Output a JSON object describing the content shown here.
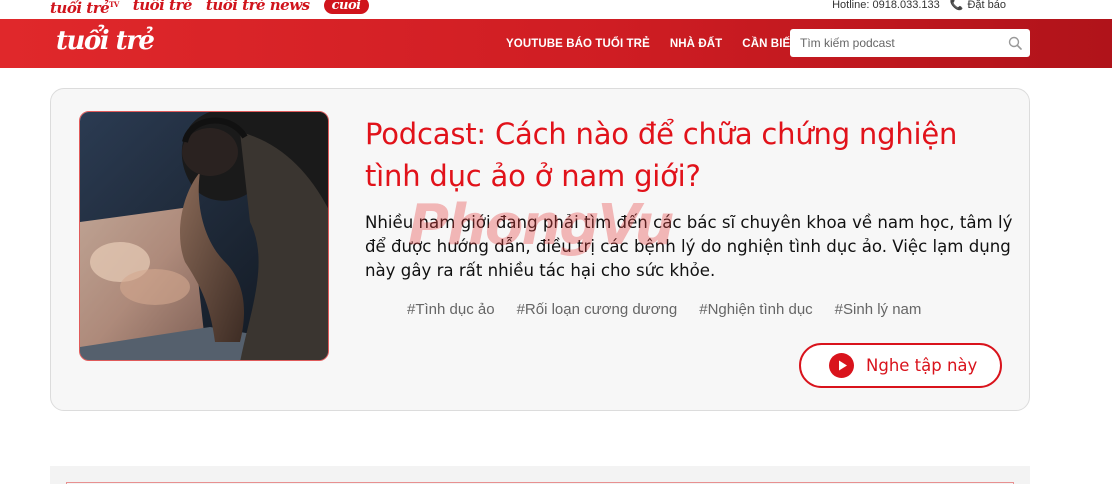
{
  "topbar": {
    "brands": [
      {
        "label": "tuổi trẻ",
        "sup": "TV"
      },
      {
        "label": "tuổi trẻ",
        "sup": ""
      },
      {
        "label": "tuổi trẻ news",
        "sup": ""
      },
      {
        "label": "cuoi",
        "sup": ""
      }
    ],
    "hotline": "Hotline: 0918.033.133",
    "order": "Đặt báo"
  },
  "header": {
    "logo": "tuổi trẻ",
    "nav": [
      "YOUTUBE BÁO TUỔI TRẺ",
      "NHÀ ĐẤT",
      "CẦN BIẾT"
    ],
    "search_placeholder": "Tìm kiếm podcast"
  },
  "podcast": {
    "title": "Podcast: Cách nào để chữa chứng nghiện tình dục ảo ở nam giới?",
    "description": "Nhiều nam giới đang phải tìm đến các bác sĩ chuyên khoa về nam học, tâm lý để được hướng dẫn, điều trị các bệnh lý do nghiện tình dục ảo. Việc lạm dụng này gây ra rất nhiều tác hại cho sức khỏe.",
    "tags": [
      "#Tình dục ảo",
      "#Rối loạn cương dương",
      "#Nghiện tình dục",
      "#Sinh lý nam"
    ],
    "listen_label": "Nghe tập này"
  },
  "watermark": {
    "part1": "Phong",
    "part2": "Vu"
  },
  "colors": {
    "brand_red": "#e1121a",
    "header_red": "#cf1d23"
  }
}
